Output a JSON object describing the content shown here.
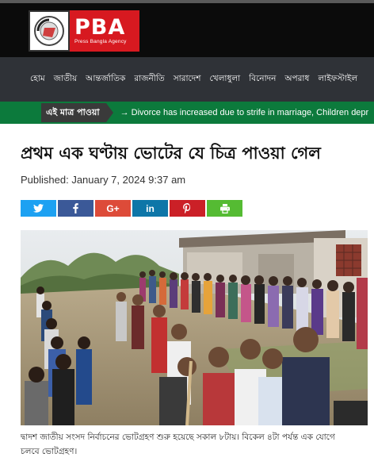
{
  "header": {
    "logo_text": "PBA",
    "logo_subtitle": "Press Bangla Agency"
  },
  "nav": {
    "items": [
      "হোম",
      "জাতীয়",
      "আন্তর্জাতিক",
      "রাজনীতি",
      "সারাদেশ",
      "খেলাধুলা",
      "বিনোদন",
      "অপরাধ",
      "লাইফস্টাইল"
    ]
  },
  "ticker": {
    "label": "এই মাত্র পাওয়া",
    "text": "→ Divorce has increased due to strife in marriage, Children depr"
  },
  "article": {
    "title": "প্রথম এক ঘণ্টায় ভোটের যে চিত্র পাওয়া গেল",
    "published": "Published: January 7, 2024 9:37 am",
    "caption_line1": "দ্বাদশ জাতীয় সংসদ নির্বাচনের ভোটগ্রহণ শুরু হয়েছে সকাল ৮টায়। বিকেল ৪টা পর্যন্ত এক যোগে",
    "caption_line2": "চলবে ভোটগ্রহণ।"
  },
  "share": {
    "twitter_icon": "twitter-icon",
    "facebook_icon": "facebook-icon",
    "googleplus_label": "G+",
    "linkedin_label": "in",
    "pinterest_icon": "pinterest-icon",
    "print_icon": "print-icon"
  },
  "colors": {
    "brand_red": "#d71920",
    "nav_bg": "#2f3237",
    "ticker_green": "#0c7a3c"
  }
}
